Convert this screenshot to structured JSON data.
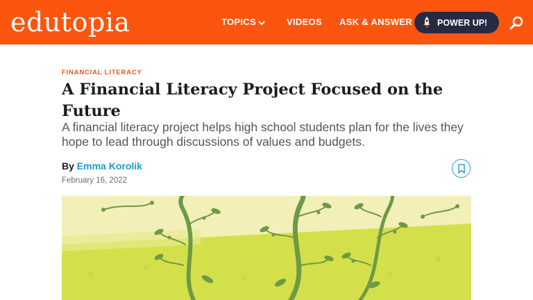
{
  "header": {
    "logo": "edutopia",
    "nav": {
      "topics": "TOPICS",
      "videos": "VIDEOS",
      "ask": "ASK & ANSWER"
    },
    "power_up": "POWER UP!"
  },
  "article": {
    "category": "FINANCIAL LITERACY",
    "title": "A Financial Literacy Project Focused on the Future",
    "subtitle": "A financial literacy project helps high school students plan for the lives they hope to lead through discussions of values and budgets.",
    "by_label": "By",
    "author": "Emma Korolik",
    "date": "February 16, 2022"
  },
  "colors": {
    "header_bg": "#fc5510",
    "power_button_bg": "#262b44",
    "category": "#e4551b",
    "author_link": "#1f9ac9",
    "hero_field": "#d4e04a",
    "hero_sky": "#f3efb8",
    "vine": "#6d9a45"
  },
  "icons": {
    "topics_caret": "chevron-down-icon",
    "power_up": "rocket-icon",
    "search": "search-icon",
    "bookmark": "bookmark-icon"
  }
}
